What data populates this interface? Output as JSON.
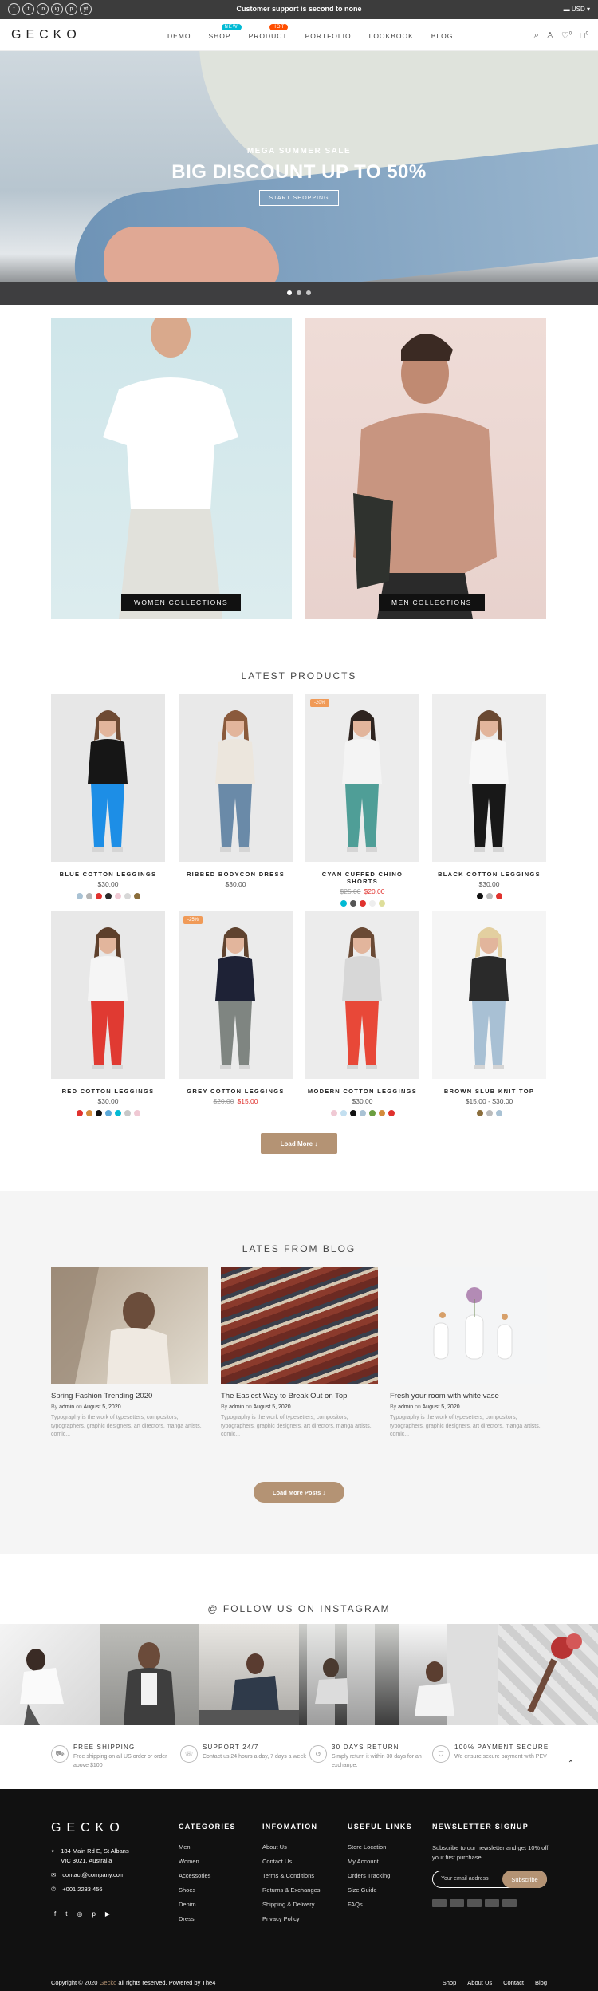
{
  "topbar": {
    "message": "Customer support is second to none",
    "currency": "USD",
    "social": [
      "f",
      "t",
      "in",
      "ig",
      "p",
      "yt"
    ]
  },
  "header": {
    "logo": "GECKO",
    "nav": [
      {
        "label": "DEMO",
        "badge": ""
      },
      {
        "label": "SHOP",
        "badge": "NEW"
      },
      {
        "label": "PRODUCT",
        "badge": "HOT"
      },
      {
        "label": "PORTFOLIO",
        "badge": ""
      },
      {
        "label": "LOOKBOOK",
        "badge": ""
      },
      {
        "label": "BLOG",
        "badge": ""
      }
    ],
    "cart_count": "0",
    "wishlist_count": "0"
  },
  "hero": {
    "subtitle": "MEGA SUMMER SALE",
    "title": "BIG DISCOUNT UP TO 50%",
    "button": "START SHOPPING"
  },
  "collections": {
    "women": "WOMEN COLLECTIONS",
    "men": "MEN COLLECTIONS"
  },
  "products": {
    "title": "LATEST PRODUCTS",
    "items": [
      {
        "name": "BLUE COTTON LEGGINGS",
        "price": "$30.00",
        "old": "",
        "sale": ""
      },
      {
        "name": "RIBBED BODYCON DRESS",
        "price": "$30.00",
        "old": "",
        "sale": ""
      },
      {
        "name": "CYAN CUFFED CHINO SHORTS",
        "price": "$20.00",
        "old": "$25.00",
        "sale": "-20%"
      },
      {
        "name": "BLACK COTTON LEGGINGS",
        "price": "$30.00",
        "old": "",
        "sale": ""
      },
      {
        "name": "RED COTTON LEGGINGS",
        "price": "$30.00",
        "old": "",
        "sale": ""
      },
      {
        "name": "GREY COTTON LEGGINGS",
        "price": "$15.00",
        "old": "$20.00",
        "sale": "-25%"
      },
      {
        "name": "MODERN COTTON LEGGINGS",
        "price": "$30.00",
        "old": "",
        "sale": ""
      },
      {
        "name": "BROWN SLUB KNIT TOP",
        "price": "$15.00 - $30.00",
        "old": "",
        "sale": ""
      }
    ],
    "load_more": "Load More"
  },
  "blog": {
    "title": "LATES FROM BLOG",
    "posts": [
      {
        "title": "Spring Fashion Trending 2020",
        "by": "By",
        "author": "admin",
        "on": "on",
        "date": "August 5, 2020",
        "desc": "Typography is the work of typesetters, compositors, typographers, graphic designers, art directors, manga artists, comic..."
      },
      {
        "title": "The Easiest Way to Break Out on Top",
        "by": "By",
        "author": "admin",
        "on": "on",
        "date": "August 5, 2020",
        "desc": "Typography is the work of typesetters, compositors, typographers, graphic designers, art directors, manga artists, comic..."
      },
      {
        "title": "Fresh your room with white vase",
        "by": "By",
        "author": "admin",
        "on": "on",
        "date": "August 5, 2020",
        "desc": "Typography is the work of typesetters, compositors, typographers, graphic designers, art directors, manga artists, comic..."
      }
    ],
    "load_more": "Load More Posts"
  },
  "instagram": {
    "title": "@ FOLLOW US ON INSTAGRAM"
  },
  "features": [
    {
      "title": "FREE SHIPPING",
      "desc": "Free shipping on all US order or order above $100"
    },
    {
      "title": "SUPPORT 24/7",
      "desc": "Contact us 24 hours a day, 7 days a week"
    },
    {
      "title": "30 DAYS RETURN",
      "desc": "Simply return it within 30 days for an exchange."
    },
    {
      "title": "100% PAYMENT SECURE",
      "desc": "We ensure secure payment with PEV"
    }
  ],
  "footer": {
    "logo": "GECKO",
    "address": "184 Main Rd E, St Albans VIC 3021, Australia",
    "email": "contact@company.com",
    "phone": "+001 2233 456",
    "columns": [
      {
        "title": "CATEGORIES",
        "links": [
          "Men",
          "Women",
          "Accessories",
          "Shoes",
          "Denim",
          "Dress"
        ]
      },
      {
        "title": "INFOMATION",
        "links": [
          "About Us",
          "Contact Us",
          "Terms & Conditions",
          "Returns & Exchanges",
          "Shipping & Delivery",
          "Privacy Policy"
        ]
      },
      {
        "title": "USEFUL LINKS",
        "links": [
          "Store Location",
          "My Account",
          "Orders Tracking",
          "Size Guide",
          "FAQs"
        ]
      }
    ],
    "newsletter": {
      "title": "NEWSLETTER SIGNUP",
      "text": "Subscribe to our newsletter and get 10% off your first purchase",
      "placeholder": "Your email address",
      "button": "Subscribe"
    },
    "copyright": "Copyright © 2020",
    "brand": "Gecko",
    "rights": "all rights reserved. Powered by The4",
    "bottom_links": [
      "Shop",
      "About Us",
      "Contact",
      "Blog"
    ]
  }
}
